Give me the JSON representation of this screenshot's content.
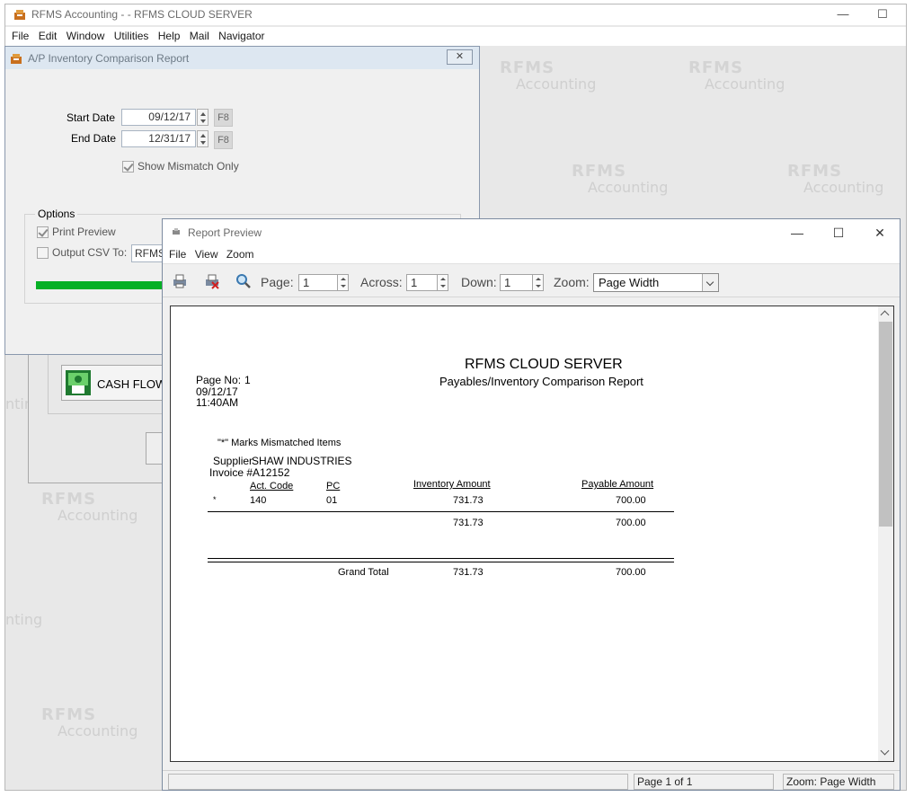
{
  "app": {
    "title": "RFMS Accounting  - - RFMS CLOUD SERVER",
    "menu": [
      "File",
      "Edit",
      "Window",
      "Utilities",
      "Help",
      "Mail",
      "Navigator"
    ],
    "minimize": "—",
    "maximize": "☐"
  },
  "watermark": {
    "line1": "RFMS",
    "line2": "Accounting"
  },
  "background_window": {
    "cashflow_label": "CASH FLOW",
    "partial_text_1": "ntin",
    "partial_text_2": "nting"
  },
  "ap_dialog": {
    "title": "A/P Inventory Comparison Report",
    "close": "✕",
    "start_date_label": "Start Date",
    "start_date": "09/12/17",
    "end_date_label": "End Date",
    "end_date": "12/31/17",
    "f8": "F8",
    "show_mismatch_label": "Show Mismatch Only",
    "options_label": "Options",
    "print_preview_label": "Print Preview",
    "output_csv_label": "Output CSV To:",
    "csv_value": "RFMS",
    "progress_percent": 100
  },
  "report_preview": {
    "title": "Report Preview",
    "menu": [
      "File",
      "View",
      "Zoom"
    ],
    "minimize": "—",
    "maximize": "☐",
    "close": "✕",
    "page_label": "Page:",
    "page_value": "1",
    "across_label": "Across:",
    "across_value": "1",
    "down_label": "Down:",
    "down_value": "1",
    "zoom_label": "Zoom:",
    "zoom_value": "Page Width",
    "status_page": "Page 1 of 1",
    "status_zoom": "Zoom: Page Width"
  },
  "report": {
    "company": "RFMS CLOUD SERVER",
    "subtitle": "Payables/Inventory Comparison Report",
    "page_no_label": "Page No:",
    "page_no": "1",
    "date": "09/12/17",
    "time": "11:40AM",
    "mismatch_note": "\"*\" Marks Mismatched Items",
    "supplier_label": "Supplier",
    "supplier": "SHAW INDUSTRIES",
    "invoice": "Invoice #A12152",
    "col_act_code": "Act. Code",
    "col_pc": "PC",
    "col_inventory": "Inventory Amount",
    "col_payable": "Payable Amount",
    "row": {
      "mark": "*",
      "act_code": "140",
      "pc": "01",
      "inventory": "731.73",
      "payable": "700.00"
    },
    "subtotal_inventory": "731.73",
    "subtotal_payable": "700.00",
    "grand_total_label": "Grand Total",
    "grand_inventory": "731.73",
    "grand_payable": "700.00"
  }
}
